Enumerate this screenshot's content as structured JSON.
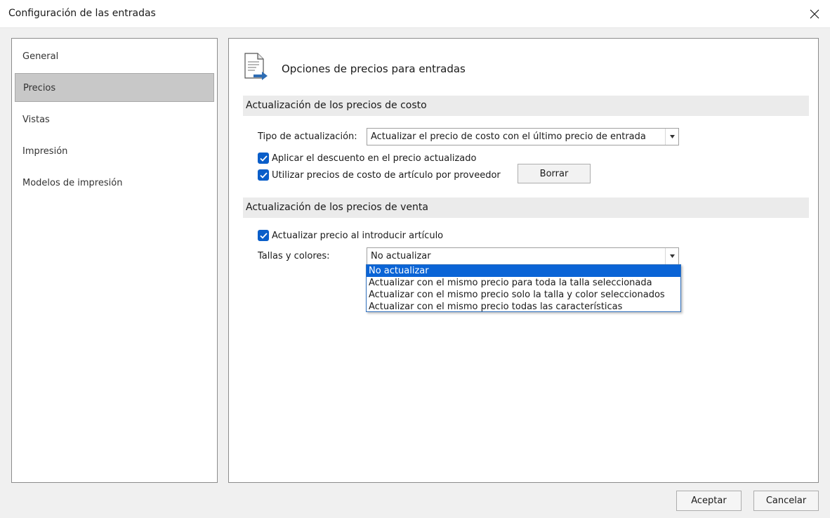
{
  "window": {
    "title": "Configuración de las entradas"
  },
  "nav": {
    "items": [
      {
        "label": "General",
        "selected": false
      },
      {
        "label": "Precios",
        "selected": true
      },
      {
        "label": "Vistas",
        "selected": false
      },
      {
        "label": "Impresión",
        "selected": false
      },
      {
        "label": "Modelos de impresión",
        "selected": false
      }
    ]
  },
  "page": {
    "title": "Opciones de precios para entradas",
    "icon": "document-arrow-icon"
  },
  "cost_section": {
    "header": "Actualización de los precios de costo",
    "type_label": "Tipo de actualización:",
    "type_value": "Actualizar el precio de costo con el último precio de entrada",
    "apply_discount_label": "Aplicar el descuento en el precio actualizado",
    "apply_discount_checked": true,
    "supplier_prices_label": "Utilizar precios de costo de artículo por proveedor",
    "supplier_prices_checked": true,
    "clear_button": "Borrar"
  },
  "sale_section": {
    "header": "Actualización de los precios de venta",
    "update_on_insert_label": "Actualizar precio al introducir artículo",
    "update_on_insert_checked": true,
    "sizes_label": "Tallas y colores:",
    "sizes_value": "No actualizar",
    "sizes_options": [
      "No actualizar",
      "Actualizar con el mismo precio para toda la talla seleccionada",
      "Actualizar con el mismo precio solo la talla y color seleccionados",
      "Actualizar con el mismo precio todas las características"
    ]
  },
  "footer": {
    "accept": "Aceptar",
    "cancel": "Cancelar"
  },
  "colors": {
    "accent": "#0a5ec9",
    "selection": "#0a64d6",
    "nav_selected": "#c8c8c8"
  }
}
